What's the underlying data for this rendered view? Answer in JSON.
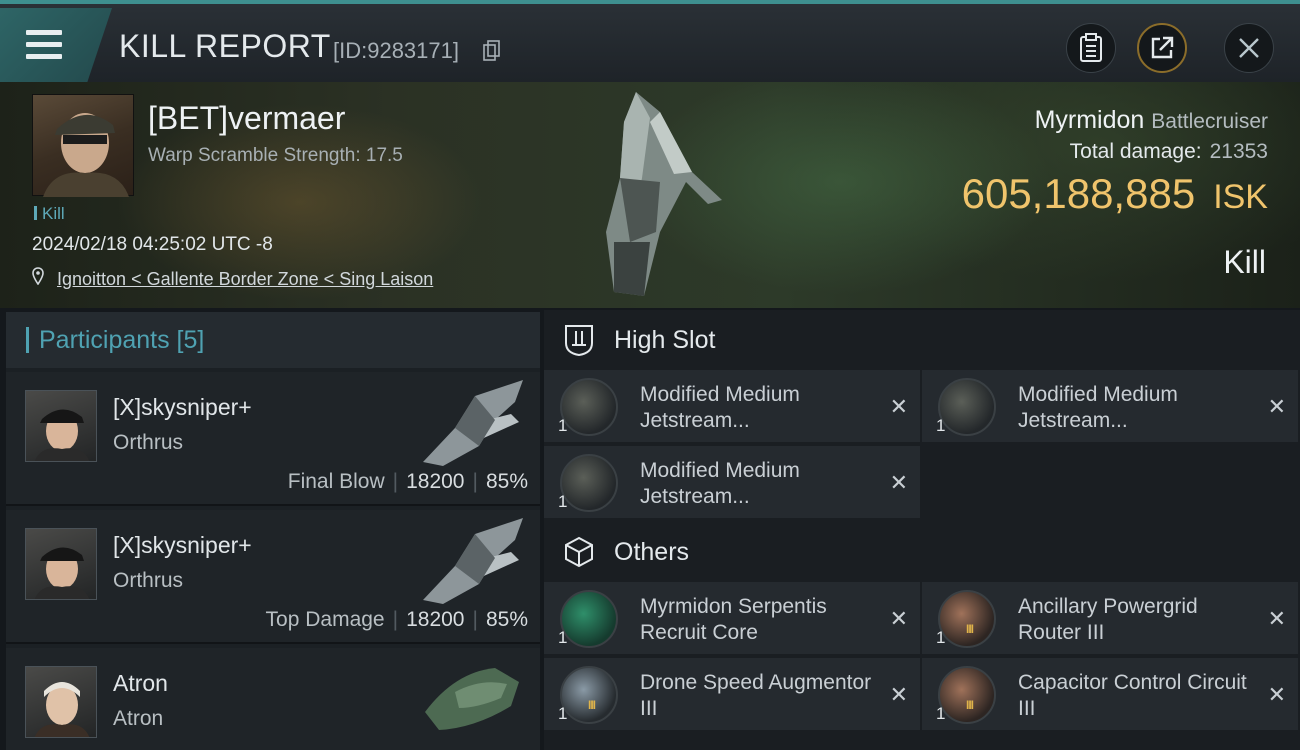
{
  "header": {
    "title": "KILL REPORT",
    "report_id": "[ID:9283171]",
    "icons": [
      "menu-icon",
      "copy-icon",
      "clipboard-icon",
      "share-icon",
      "close-icon"
    ]
  },
  "victim": {
    "name": "[BET]vermaer",
    "warp_scramble": "Warp Scramble Strength: 17.5",
    "tag": "Kill",
    "datetime": "2024/02/18 04:25:02 UTC -8",
    "location": "Ignoitton < Gallente Border Zone < Sing Laison",
    "ship": "Myrmidon",
    "ship_class": "Battlecruiser",
    "total_damage_label": "Total damage:",
    "total_damage": "21353",
    "isk_value": "605,188,885",
    "isk_unit": "ISK",
    "result": "Kill"
  },
  "participants": {
    "header": "Participants [5]",
    "items": [
      {
        "name": "[X]skysniper+",
        "ship": "Orthrus",
        "role": "Final Blow",
        "damage": "18200",
        "percent": "85%"
      },
      {
        "name": "[X]skysniper+",
        "ship": "Orthrus",
        "role": "Top Damage",
        "damage": "18200",
        "percent": "85%"
      },
      {
        "name": "Atron",
        "ship": "Atron",
        "role": "",
        "damage": "",
        "percent": ""
      }
    ]
  },
  "high_slot": {
    "title": "High Slot",
    "modules": [
      {
        "name": "Modified Medium Jetstream...",
        "qty": "1",
        "tier": ""
      },
      {
        "name": "Modified Medium Jetstream...",
        "qty": "1",
        "tier": ""
      },
      {
        "name": "Modified Medium Jetstream...",
        "qty": "1",
        "tier": ""
      }
    ]
  },
  "others": {
    "title": "Others",
    "modules": [
      {
        "name": "Myrmidon Serpentis Recruit Core",
        "qty": "1",
        "tier": ""
      },
      {
        "name": "Ancillary Powergrid Router III",
        "qty": "1",
        "tier": "III"
      },
      {
        "name": "Drone Speed Augmentor III",
        "qty": "1",
        "tier": "III"
      },
      {
        "name": "Capacitor Control Circuit III",
        "qty": "1",
        "tier": "III"
      }
    ]
  },
  "remove_symbol": "✕"
}
